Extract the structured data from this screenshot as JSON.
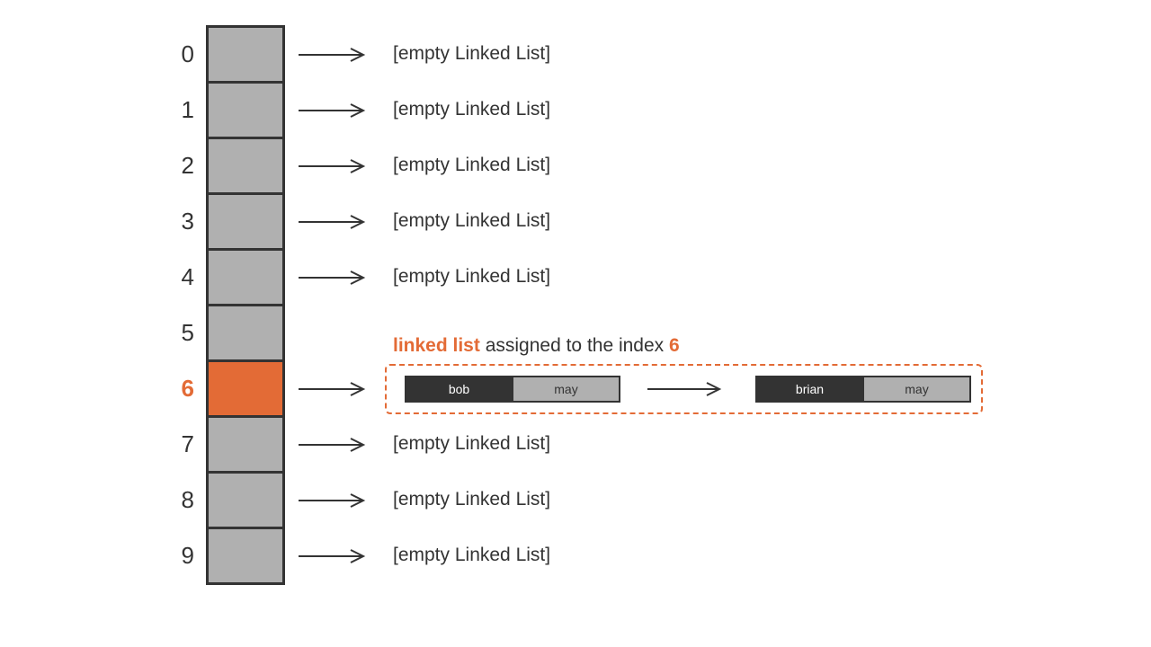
{
  "colors": {
    "accent": "#e36b36",
    "cell_fill": "#b0b0b0",
    "node_dark": "#333333",
    "text": "#333333"
  },
  "array_size": 10,
  "highlight_index": 6,
  "empty_text": "[empty Linked List]",
  "indices": {
    "0": "0",
    "1": "1",
    "2": "2",
    "3": "3",
    "4": "4",
    "5": "5",
    "6": "6",
    "7": "7",
    "8": "8",
    "9": "9"
  },
  "buckets": {
    "0": "[empty Linked List]",
    "1": "[empty Linked List]",
    "2": "[empty Linked List]",
    "3": "[empty Linked List]",
    "4": "[empty Linked List]",
    "7": "[empty Linked List]",
    "8": "[empty Linked List]",
    "9": "[empty Linked List]"
  },
  "caption": {
    "strong1": "linked list",
    "mid": " assigned to the index ",
    "strong2": "6"
  },
  "linked_list": {
    "node1": {
      "key": "bob",
      "val": "may"
    },
    "node2": {
      "key": "brian",
      "val": "may"
    }
  }
}
